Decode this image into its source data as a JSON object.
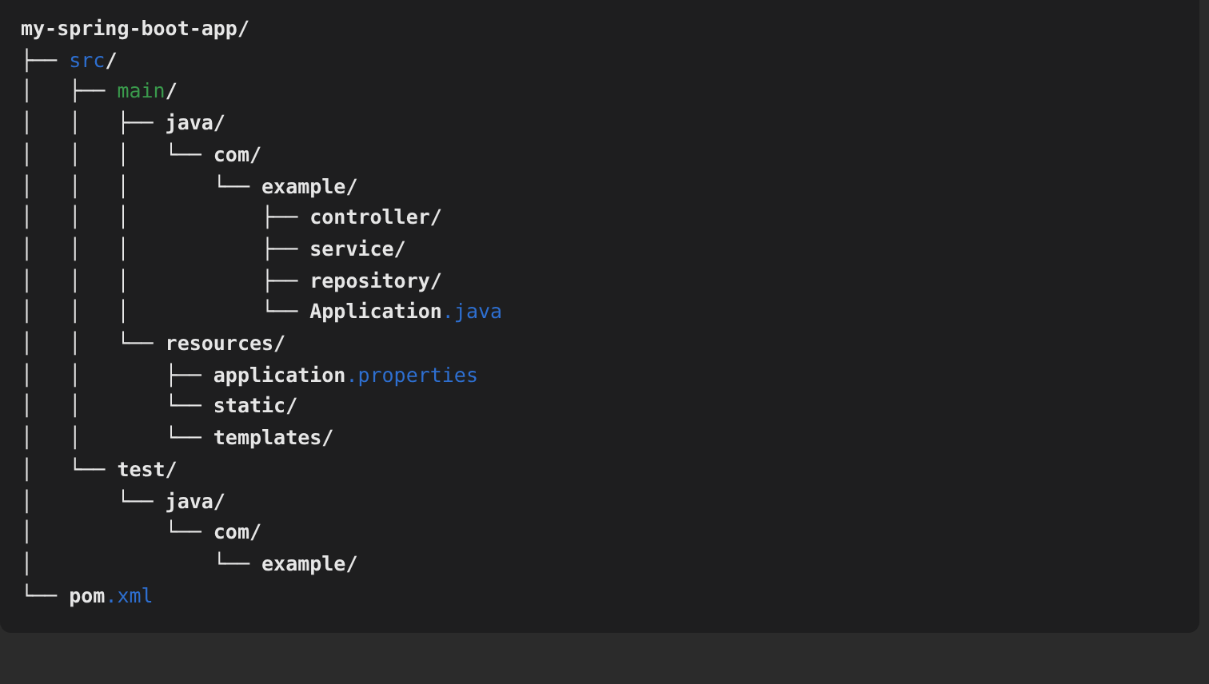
{
  "code_block": {
    "lines": [
      [
        {
          "text": "my-spring-boot-app/",
          "kind": "plain"
        }
      ],
      [
        {
          "text": "├── ",
          "kind": "plain"
        },
        {
          "text": "src",
          "kind": "blue"
        },
        {
          "text": "/",
          "kind": "plain"
        }
      ],
      [
        {
          "text": "│   ├── ",
          "kind": "plain"
        },
        {
          "text": "main",
          "kind": "green"
        },
        {
          "text": "/",
          "kind": "plain"
        }
      ],
      [
        {
          "text": "│   │   ├── java/",
          "kind": "plain"
        }
      ],
      [
        {
          "text": "│   │   │   └── com/",
          "kind": "plain"
        }
      ],
      [
        {
          "text": "│   │   │       └── example/",
          "kind": "plain"
        }
      ],
      [
        {
          "text": "│   │   │           ├── controller/",
          "kind": "plain"
        }
      ],
      [
        {
          "text": "│   │   │           ├── service/",
          "kind": "plain"
        }
      ],
      [
        {
          "text": "│   │   │           ├── repository/",
          "kind": "plain"
        }
      ],
      [
        {
          "text": "│   │   │           └── Application",
          "kind": "plain"
        },
        {
          "text": ".java",
          "kind": "blue"
        }
      ],
      [
        {
          "text": "│   │   └── resources/",
          "kind": "plain"
        }
      ],
      [
        {
          "text": "│   │       ├── application",
          "kind": "plain"
        },
        {
          "text": ".properties",
          "kind": "blue"
        }
      ],
      [
        {
          "text": "│   │       └── static/",
          "kind": "plain"
        }
      ],
      [
        {
          "text": "│   │       └── templates/",
          "kind": "plain"
        }
      ],
      [
        {
          "text": "│   └── test/",
          "kind": "plain"
        }
      ],
      [
        {
          "text": "│       └── java/",
          "kind": "plain"
        }
      ],
      [
        {
          "text": "│           └── com/",
          "kind": "plain"
        }
      ],
      [
        {
          "text": "│               └── example/",
          "kind": "plain"
        }
      ],
      [
        {
          "text": "└── pom",
          "kind": "plain"
        },
        {
          "text": ".xml",
          "kind": "blue"
        }
      ]
    ]
  }
}
